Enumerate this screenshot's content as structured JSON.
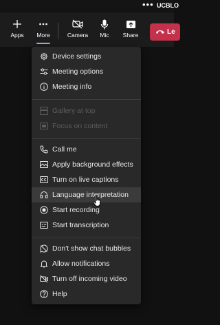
{
  "top_bar": {
    "more_dots": "•••",
    "org_label": "UCBLO"
  },
  "toolbar": {
    "buttons": [
      {
        "label": "Apps",
        "icon": "plus-icon"
      },
      {
        "label": "More",
        "icon": "more-dots-icon"
      },
      {
        "label": "Camera",
        "icon": "camera-off-icon"
      },
      {
        "label": "Mic",
        "icon": "mic-icon"
      },
      {
        "label": "Share",
        "icon": "share-icon"
      }
    ],
    "leave_label": "Le",
    "leave_color": "#c4314b"
  },
  "menu": {
    "group1": [
      {
        "label": "Device settings",
        "icon": "gear-icon"
      },
      {
        "label": "Meeting options",
        "icon": "sliders-icon"
      },
      {
        "label": "Meeting info",
        "icon": "info-icon"
      }
    ],
    "group2": [
      {
        "label": "Gallery at top",
        "icon": "gallery-icon",
        "disabled": true
      },
      {
        "label": "Focus on content",
        "icon": "focus-icon",
        "disabled": true
      }
    ],
    "group3": [
      {
        "label": "Call me",
        "icon": "phone-icon"
      },
      {
        "label": "Apply background effects",
        "icon": "background-effects-icon"
      },
      {
        "label": "Turn on live captions",
        "icon": "captions-icon"
      },
      {
        "label": "Language interpretation",
        "icon": "headset-icon",
        "hovered": true
      },
      {
        "label": "Start recording",
        "icon": "record-icon"
      },
      {
        "label": "Start transcription",
        "icon": "transcript-icon"
      }
    ],
    "group4": [
      {
        "label": "Don't show chat bubbles",
        "icon": "chat-bubble-off-icon"
      },
      {
        "label": "Allow notifications",
        "icon": "bell-icon"
      },
      {
        "label": "Turn off incoming video",
        "icon": "video-off-icon"
      },
      {
        "label": "Help",
        "icon": "help-icon"
      }
    ]
  }
}
